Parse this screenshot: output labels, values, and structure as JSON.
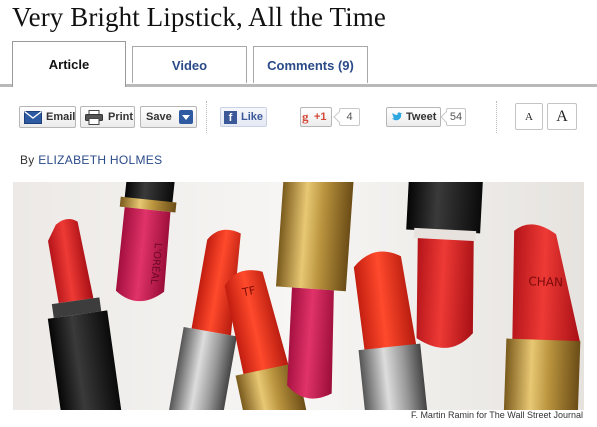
{
  "headline": "Very Bright Lipstick, All the Time",
  "tabs": [
    {
      "label": "Article"
    },
    {
      "label": "Video"
    },
    {
      "label": "Comments (9)"
    }
  ],
  "toolbar": {
    "email_label": "Email",
    "print_label": "Print",
    "save_label": "Save",
    "like_label": "Like",
    "gplus_label": "+1",
    "gplus_count": "4",
    "tweet_label": "Tweet",
    "tweet_count": "54",
    "font_small": "A",
    "font_large": "A"
  },
  "byline": {
    "prefix": "By",
    "author": "ELIZABETH HOLMES"
  },
  "photo": {
    "credit": "F. Martin Ramin for The Wall Street Journal",
    "brand_loreal": "L'ORÉAL",
    "brand_tomford": "TF",
    "brand_chanel": "CHAN"
  },
  "colors": {
    "link": "#2a4a88",
    "tab_border": "#a8a8a8",
    "twitter": "#2ea6e0",
    "facebook": "#3b5998",
    "gplus": "#d34836"
  }
}
